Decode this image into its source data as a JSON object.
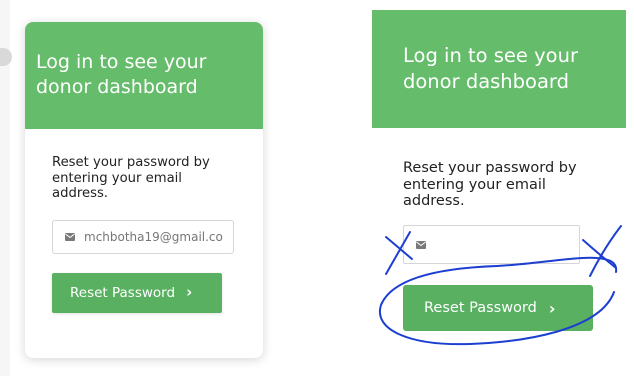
{
  "colors": {
    "header_green": "#65bd6b",
    "button_green": "#58b060",
    "annotation_blue": "#1c3fd0"
  },
  "left_panel": {
    "title": "Log in to see your donor dashboard",
    "description": "Reset your password by entering your email address.",
    "email": {
      "icon": "envelope-icon",
      "value": "mchbotha19@gmail.co"
    },
    "reset_button": {
      "label": "Reset Password",
      "icon": "chevron-right-icon"
    }
  },
  "right_panel": {
    "title": "Log in to see your donor dashboard",
    "description": "Reset your password by entering your email address.",
    "email": {
      "icon": "envelope-icon",
      "value": ""
    },
    "reset_button": {
      "label": "Reset Password",
      "icon": "chevron-right-icon"
    },
    "annotations": [
      "cross-mark-left",
      "cross-mark-right",
      "circle-around-button"
    ]
  }
}
